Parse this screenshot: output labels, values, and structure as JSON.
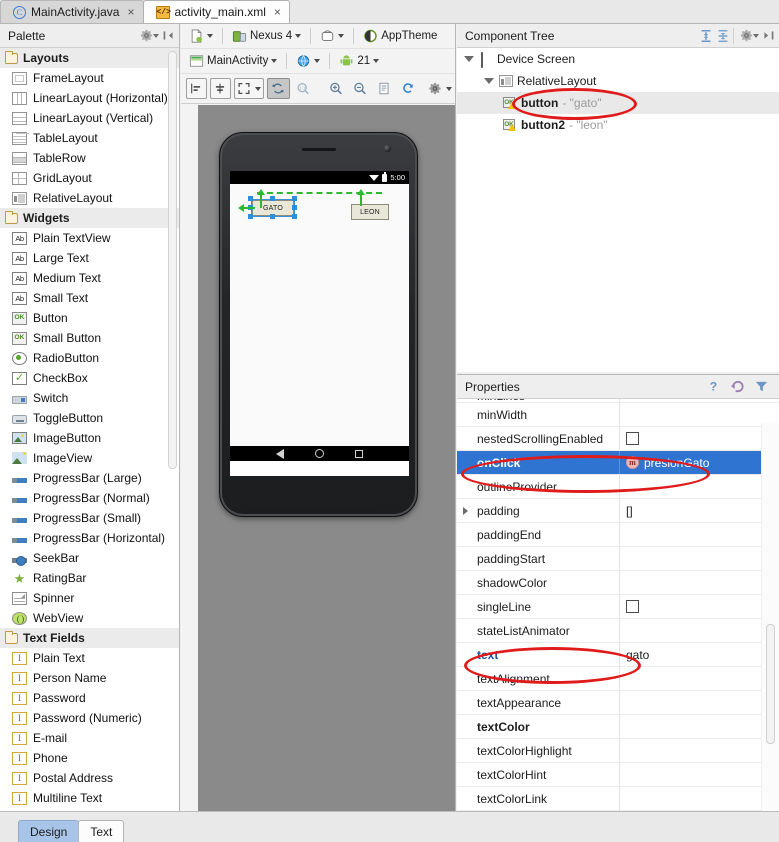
{
  "window": {
    "editor_tabs": [
      {
        "label": "MainActivity.java",
        "icon": "java-class-icon",
        "active": false,
        "close": "×"
      },
      {
        "label": "activity_main.xml",
        "icon": "xml-file-icon",
        "active": true,
        "close": "×"
      }
    ]
  },
  "palette": {
    "title": "Palette",
    "header_icons": [
      "gear-icon",
      "collapse-panel-icon"
    ],
    "groups": [
      {
        "label": "Layouts",
        "items": [
          {
            "label": "FrameLayout",
            "icon": "frame-layout-icon"
          },
          {
            "label": "LinearLayout (Horizontal)",
            "icon": "linear-layout-horizontal-icon"
          },
          {
            "label": "LinearLayout (Vertical)",
            "icon": "linear-layout-vertical-icon"
          },
          {
            "label": "TableLayout",
            "icon": "table-layout-icon"
          },
          {
            "label": "TableRow",
            "icon": "table-row-icon"
          },
          {
            "label": "GridLayout",
            "icon": "grid-layout-icon"
          },
          {
            "label": "RelativeLayout",
            "icon": "relative-layout-icon"
          }
        ]
      },
      {
        "label": "Widgets",
        "items": [
          {
            "label": "Plain TextView",
            "icon": "text-ab-icon",
            "glyph": "Ab"
          },
          {
            "label": "Large Text",
            "icon": "text-ab-icon",
            "glyph": "Ab"
          },
          {
            "label": "Medium Text",
            "icon": "text-ab-icon",
            "glyph": "Ab"
          },
          {
            "label": "Small Text",
            "icon": "text-ab-icon",
            "glyph": "Ab"
          },
          {
            "label": "Button",
            "icon": "button-ok-icon",
            "glyph": "OK"
          },
          {
            "label": "Small Button",
            "icon": "button-ok-icon",
            "glyph": "OK"
          },
          {
            "label": "RadioButton",
            "icon": "radio-button-icon"
          },
          {
            "label": "CheckBox",
            "icon": "checkbox-icon",
            "glyph": "✓"
          },
          {
            "label": "Switch",
            "icon": "switch-icon"
          },
          {
            "label": "ToggleButton",
            "icon": "toggle-button-icon"
          },
          {
            "label": "ImageButton",
            "icon": "image-button-icon"
          },
          {
            "label": "ImageView",
            "icon": "image-view-icon"
          },
          {
            "label": "ProgressBar (Large)",
            "icon": "progress-bar-icon"
          },
          {
            "label": "ProgressBar (Normal)",
            "icon": "progress-bar-icon"
          },
          {
            "label": "ProgressBar (Small)",
            "icon": "progress-bar-icon"
          },
          {
            "label": "ProgressBar (Horizontal)",
            "icon": "progress-bar-icon"
          },
          {
            "label": "SeekBar",
            "icon": "seek-bar-icon"
          },
          {
            "label": "RatingBar",
            "icon": "rating-bar-icon",
            "glyph": "★"
          },
          {
            "label": "Spinner",
            "icon": "spinner-icon"
          },
          {
            "label": "WebView",
            "icon": "web-view-icon"
          }
        ]
      },
      {
        "label": "Text Fields",
        "items": [
          {
            "label": "Plain Text",
            "icon": "text-field-icon",
            "glyph": "I"
          },
          {
            "label": "Person Name",
            "icon": "text-field-icon",
            "glyph": "I"
          },
          {
            "label": "Password",
            "icon": "text-field-icon",
            "glyph": "I"
          },
          {
            "label": "Password (Numeric)",
            "icon": "text-field-icon",
            "glyph": "I"
          },
          {
            "label": "E-mail",
            "icon": "text-field-icon",
            "glyph": "I"
          },
          {
            "label": "Phone",
            "icon": "text-field-icon",
            "glyph": "I"
          },
          {
            "label": "Postal Address",
            "icon": "text-field-icon",
            "glyph": "I"
          },
          {
            "label": "Multiline Text",
            "icon": "text-field-icon",
            "glyph": "I"
          }
        ]
      }
    ]
  },
  "design_toolbar": {
    "row1": [
      {
        "label": "",
        "icon": "device-config-icon",
        "caret": true
      },
      {
        "label": "Nexus 4",
        "icon": "device-icon",
        "caret": true
      },
      {
        "label": "",
        "icon": "orientation-icon",
        "caret": true
      },
      {
        "label": "AppTheme",
        "icon": "theme-icon",
        "caret": false
      }
    ],
    "row2": [
      {
        "label": "MainActivity",
        "icon": "activity-icon",
        "caret": true
      },
      {
        "label": "",
        "icon": "locale-globe-icon",
        "caret": true
      },
      {
        "label": "21",
        "icon": "android-api-icon",
        "caret": true
      }
    ],
    "row3": [
      {
        "icon": "align-left-icon",
        "boxed": true,
        "pressed": false
      },
      {
        "icon": "distribute-icon",
        "boxed": true,
        "pressed": false
      },
      {
        "icon": "expand-icon",
        "boxed": true,
        "pressed": false,
        "caret": true
      },
      {
        "icon": "zoom-fit-icon",
        "boxed": true,
        "pressed": true
      },
      {
        "icon": "zoom-actual-icon",
        "boxed": false,
        "pressed": false
      },
      {
        "icon": "zoom-in-icon",
        "boxed": false,
        "pressed": false
      },
      {
        "icon": "zoom-out-icon",
        "boxed": false,
        "pressed": false
      },
      {
        "icon": "file-icon",
        "boxed": false,
        "pressed": false
      },
      {
        "icon": "refresh-icon",
        "boxed": false,
        "pressed": false
      },
      {
        "icon": "settings-gear-icon",
        "boxed": false,
        "pressed": false
      }
    ]
  },
  "preview": {
    "device": "Nexus 4",
    "status_time": "5:00",
    "status_icons": [
      "wifi-icon",
      "battery-icon"
    ],
    "nav_icons": [
      "back-icon",
      "home-icon",
      "recents-icon"
    ],
    "widgets": [
      {
        "label": "GATO",
        "selected": true
      },
      {
        "label": "LEON",
        "selected": false
      }
    ]
  },
  "component_tree": {
    "title": "Component Tree",
    "header_icons": [
      "expand-all-icon",
      "collapse-all-icon",
      "gear-icon",
      "hide-panel-icon"
    ],
    "nodes": [
      {
        "label": "Device Screen",
        "id": "",
        "depth": 0,
        "icon": "device-screen-icon",
        "expanded": true,
        "selected": false
      },
      {
        "label": "RelativeLayout",
        "id": "",
        "depth": 1,
        "icon": "relative-layout-icon",
        "expanded": true,
        "selected": false
      },
      {
        "label": "button",
        "id": "- \"gato\"",
        "depth": 2,
        "icon": "button-warning-icon",
        "expanded": false,
        "selected": true
      },
      {
        "label": "button2",
        "id": "- \"leon\"",
        "depth": 2,
        "icon": "button-warning-icon",
        "expanded": false,
        "selected": false
      }
    ]
  },
  "properties": {
    "title": "Properties",
    "header_icons": [
      "help-icon",
      "revert-icon",
      "filter-icon"
    ],
    "rows": [
      {
        "name": "minLines",
        "value": "",
        "type": "text",
        "clipped": true
      },
      {
        "name": "minWidth",
        "value": "",
        "type": "text"
      },
      {
        "name": "nestedScrollingEnabled",
        "value": "",
        "type": "checkbox"
      },
      {
        "name": "onClick",
        "value": "presionGato",
        "type": "method",
        "selected": true,
        "badge": "m"
      },
      {
        "name": "outlineProvider",
        "value": "",
        "type": "text",
        "clipped": true
      },
      {
        "name": "padding",
        "value": "[]",
        "type": "text",
        "expandable": true
      },
      {
        "name": "paddingEnd",
        "value": "",
        "type": "text"
      },
      {
        "name": "paddingStart",
        "value": "",
        "type": "text"
      },
      {
        "name": "shadowColor",
        "value": "",
        "type": "text"
      },
      {
        "name": "singleLine",
        "value": "",
        "type": "checkbox"
      },
      {
        "name": "stateListAnimator",
        "value": "",
        "type": "text",
        "clipped": true
      },
      {
        "name": "text",
        "value": "gato",
        "type": "text",
        "modified": true
      },
      {
        "name": "textAlignment",
        "value": "",
        "type": "text",
        "clipped": true
      },
      {
        "name": "textAppearance",
        "value": "",
        "type": "text"
      },
      {
        "name": "textColor",
        "value": "",
        "type": "text",
        "bold": true
      },
      {
        "name": "textColorHighlight",
        "value": "",
        "type": "text"
      },
      {
        "name": "textColorHint",
        "value": "",
        "type": "text"
      },
      {
        "name": "textColorLink",
        "value": "",
        "type": "text",
        "clipped": true
      }
    ]
  },
  "bottom_tabs": [
    {
      "label": "Design",
      "active": true
    },
    {
      "label": "Text",
      "active": false
    }
  ],
  "colors": {
    "selection_blue": "#2f74d0",
    "annotation_red": "#e01b1b",
    "guide_green": "#2eb82e",
    "handle_blue": "#2a8fe0"
  }
}
